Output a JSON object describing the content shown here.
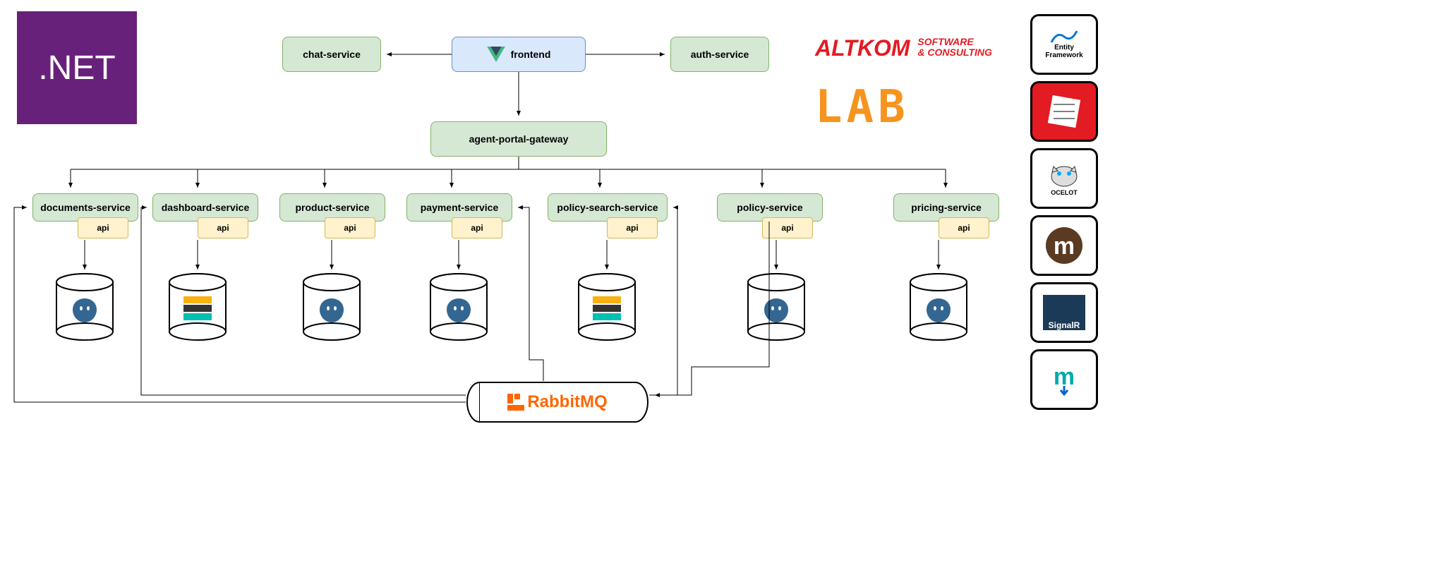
{
  "dotnet_label": ".NET",
  "nodes": {
    "chat": "chat-service",
    "frontend": "frontend",
    "auth": "auth-service",
    "gateway": "agent-portal-gateway",
    "documents": "documents-service",
    "dashboard": "dashboard-service",
    "product": "product-service",
    "payment": "payment-service",
    "policy_search": "policy-search-service",
    "policy": "policy-service",
    "pricing": "pricing-service"
  },
  "api_label": "api",
  "rabbit_label": "RabbitMQ",
  "brands": {
    "altkom_main": "ALTKOM",
    "altkom_sub1": "SOFTWARE",
    "altkom_sub2": "& CONSULTING",
    "lab": "LAB"
  },
  "tech_stack": {
    "ef_top": "Entity",
    "ef_bottom": "Framework",
    "nhibernate": "",
    "ocelot": "OCELOT",
    "marten": "m",
    "signalr": "SignalR",
    "mediatr": "m"
  }
}
